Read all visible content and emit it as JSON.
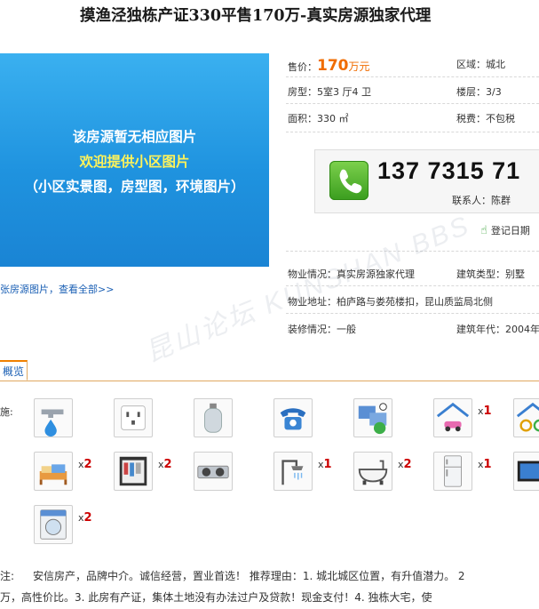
{
  "title": "摸渔泾独栋产证330平售170万-真实房源独家代理",
  "photo": {
    "line1": "该房源暂无相应图片",
    "line2": "欢迎提供小区图片",
    "line3": "（小区实景图，房型图，环境图片）",
    "link_text": "张房源图片，查看全部>>"
  },
  "info": {
    "price_label": "售价：",
    "price_value": "170",
    "price_unit": "万元",
    "area_label": "区域：",
    "area_value": "城北",
    "layout_label": "房型：",
    "layout_value": "5室3 厅4 卫",
    "floor_label": "楼层：",
    "floor_value": "3/3",
    "size_label": "面积：",
    "size_value": "330 ㎡",
    "tax_label": "税费：",
    "tax_value": "不包税",
    "property_label": "物业情况：",
    "property_value": "真实房源独家代理",
    "type_label": "建筑类型：",
    "type_value": "别墅",
    "address_label": "物业地址：",
    "address_value": "柏庐路与娄苑楼扣，昆山质监局北侧",
    "decor_label": "装修情况：",
    "decor_value": "一般",
    "year_label": "建筑年代：",
    "year_value": "2004年"
  },
  "phone": {
    "number": "137 7315 71",
    "contact": "联系人：陈群"
  },
  "register": "登记日期",
  "watermark": "昆山论坛 KUNSHAN BBS",
  "tab_label": "概览",
  "facilities_label": "施:",
  "facilities": [
    {
      "icon": "water-heater-icon",
      "qty": ""
    },
    {
      "icon": "power-outlet-icon",
      "qty": ""
    },
    {
      "icon": "gas-tank-icon",
      "qty": ""
    },
    {
      "icon": "telephone-icon",
      "qty": ""
    },
    {
      "icon": "network-icon",
      "qty": ""
    },
    {
      "icon": "garage-icon",
      "qty": "1"
    },
    {
      "icon": "bicycle-icon",
      "qty": ""
    },
    {
      "icon": "bed-icon",
      "qty": "2"
    },
    {
      "icon": "wardrobe-icon",
      "qty": "2"
    },
    {
      "icon": "gas-stove-icon",
      "qty": ""
    },
    {
      "icon": "shower-icon",
      "qty": "1"
    },
    {
      "icon": "bathtub-icon",
      "qty": "2"
    },
    {
      "icon": "refrigerator-icon",
      "qty": "1"
    },
    {
      "icon": "tv-icon",
      "qty": ""
    },
    {
      "icon": "washing-machine-icon",
      "qty": "2"
    }
  ],
  "qty_prefix": "x",
  "note_label": "注:",
  "note_line1": "安信房产，品牌中介。诚信经营，置业首选！ 推荐理由：1. 城北城区位置，有升值潜力。 2",
  "note_line2": "万，高性价比。3. 此房有产证，集体土地没有办法过户及贷款！现金支付！4. 独栋大宅，使"
}
